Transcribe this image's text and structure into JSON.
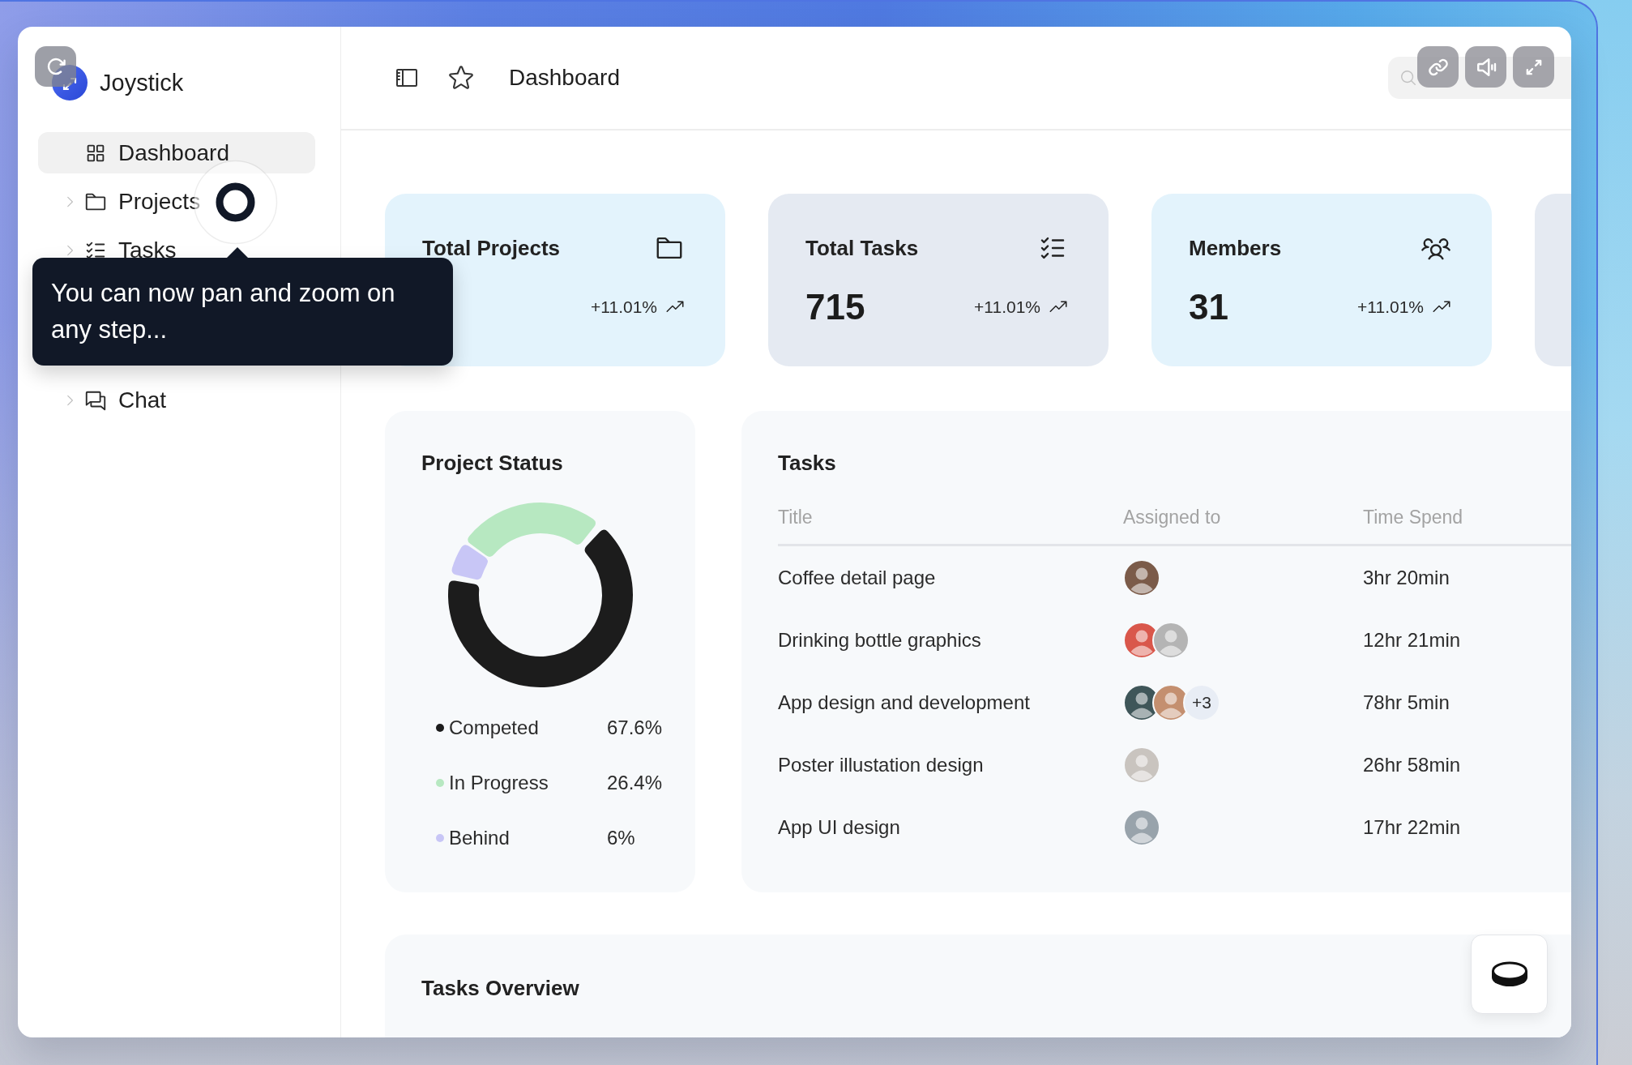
{
  "brand": {
    "name": "Joystick"
  },
  "sidebar": {
    "items": [
      {
        "label": "Dashboard",
        "kind": "grid",
        "expandable": false,
        "selected": true
      },
      {
        "label": "Projects",
        "kind": "folder",
        "expandable": true,
        "selected": false
      },
      {
        "label": "Tasks",
        "kind": "checklist",
        "expandable": true,
        "selected": false
      },
      {
        "label": "Chat",
        "kind": "chat",
        "expandable": true,
        "selected": false
      }
    ]
  },
  "header": {
    "title": "Dashboard"
  },
  "stats": [
    {
      "kind": "folder",
      "title": "Total Projects",
      "change": "+11.01%",
      "color": "#e3f3fc"
    },
    {
      "kind": "checklist",
      "title": "Total Tasks",
      "value": "715",
      "change": "+11.01%",
      "color": "#e5eaf2"
    },
    {
      "kind": "team",
      "title": "Members",
      "value": "31",
      "change": "+11.01%",
      "color": "#e3f3fc"
    },
    {
      "kind": "empty",
      "color": "#e5eaf2"
    }
  ],
  "project_status": {
    "title": "Project Status",
    "chart_data": {
      "type": "donut",
      "categories": [
        "Competed",
        "In Progress",
        "Behind"
      ],
      "values": [
        67.6,
        26.4,
        6
      ]
    },
    "legend": [
      {
        "reading": "67.6%",
        "color": "#1c1c1c"
      },
      {
        "reading": "26.4%",
        "color": "#b7e8c1"
      },
      {
        "reading": "6%",
        "color": "#c8c6f6"
      }
    ]
  },
  "tasks": {
    "title": "Tasks",
    "columns": [
      "Title",
      "Assigned to",
      "Time Spend"
    ],
    "rows": [
      {
        "title": "Coffee detail page",
        "assignees": [
          {
            "kind": "photo"
          }
        ],
        "time": "3hr 20min"
      },
      {
        "title": "Drinking bottle graphics",
        "assignees": [
          {
            "kind": "photo"
          },
          {
            "kind": "photo"
          }
        ],
        "time": "12hr 21min"
      },
      {
        "title": "App design and development",
        "assignees": [
          {
            "kind": "photo"
          },
          {
            "kind": "photo"
          }
        ],
        "more": "+3",
        "time": "78hr 5min"
      },
      {
        "title": "Poster illustation design",
        "assignees": [
          {
            "kind": "photo"
          }
        ],
        "time": "26hr 58min"
      },
      {
        "title": "App UI design",
        "assignees": [
          {
            "kind": "photo"
          }
        ],
        "time": "17hr 22min"
      }
    ]
  },
  "tasks_overview": {
    "title": "Tasks Overview"
  },
  "tour": {
    "text": "You can now pan and zoom on any step..."
  }
}
